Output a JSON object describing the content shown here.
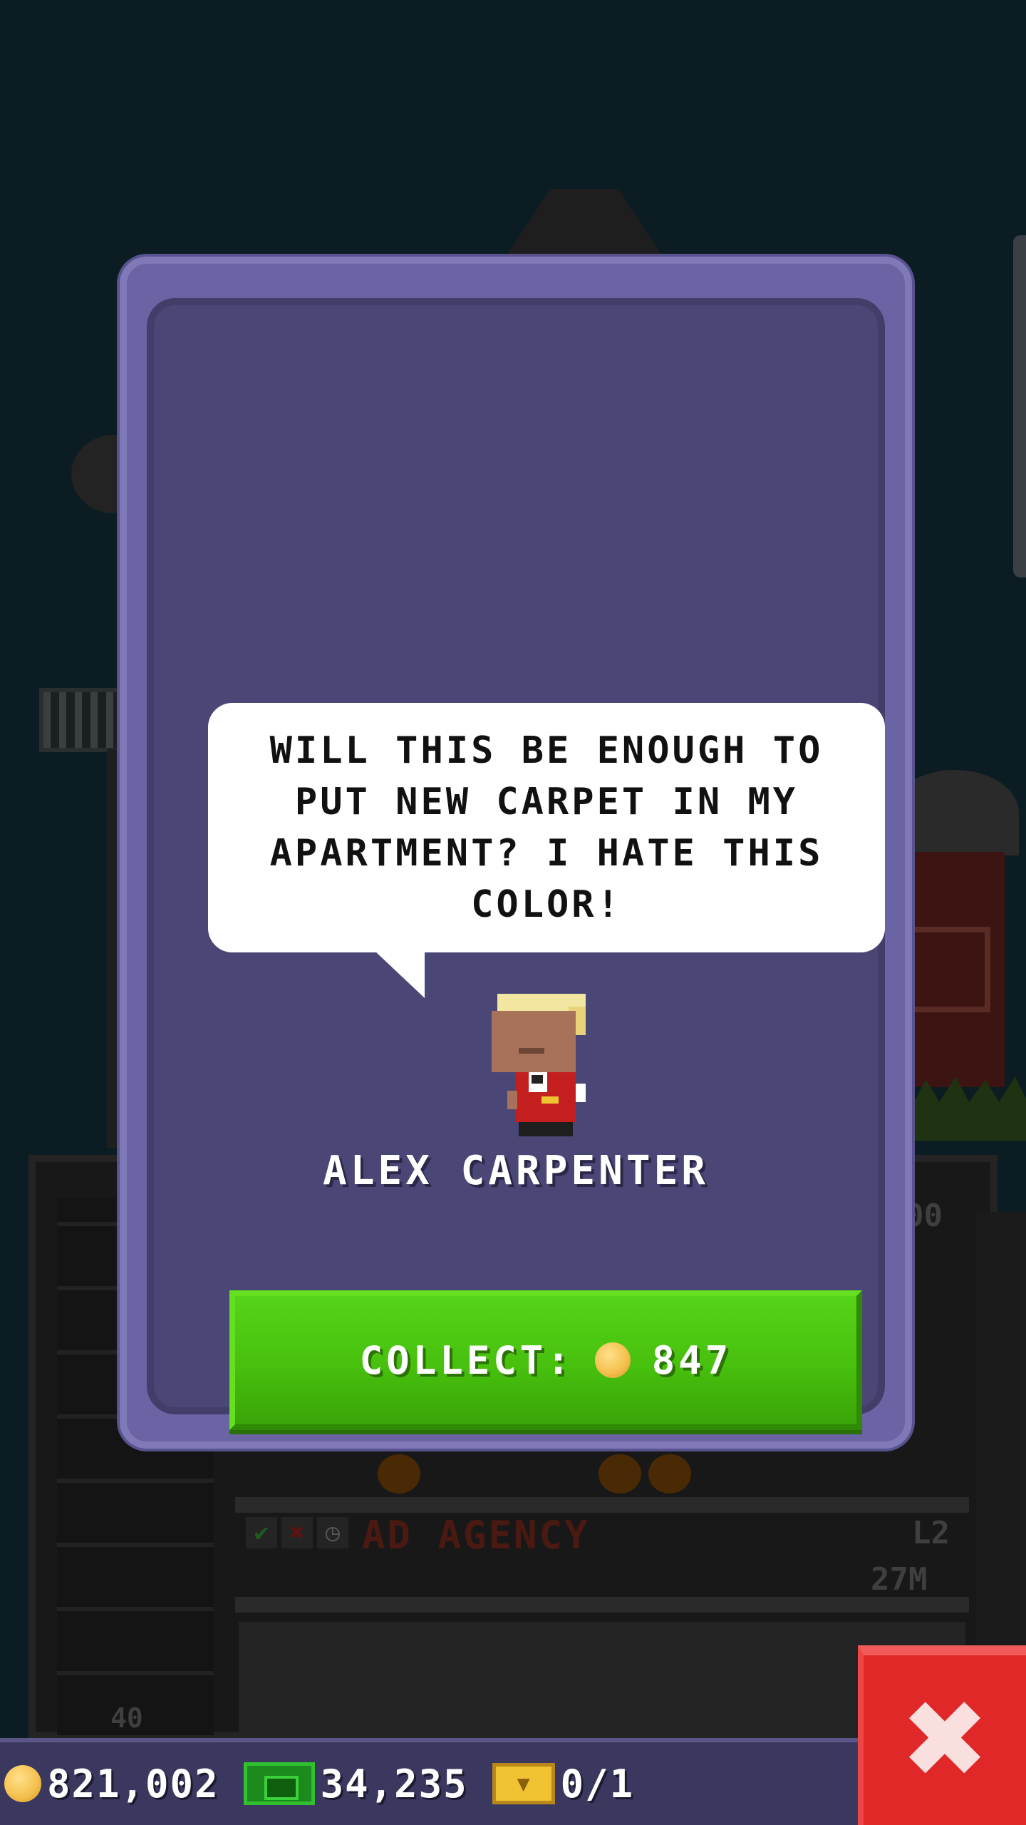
{
  "dialog": {
    "quote": "WILL THIS BE ENOUGH TO PUT NEW CARPET IN MY APARTMENT? I HATE THIS COLOR!",
    "character_name": "ALEX CARPENTER",
    "collect_label": "COLLECT:",
    "collect_amount": "847"
  },
  "background": {
    "floor_name": "AD AGENCY",
    "floor_level": "L2",
    "floor_income": "27M",
    "side_value": "00",
    "floor_number": "40"
  },
  "bottom_bar": {
    "coins": "821,002",
    "bux": "34,235",
    "tickets": "0/1"
  },
  "icons": {
    "coin": "coin-icon",
    "bux": "bux-icon",
    "ticket": "golden-ticket-icon",
    "close": "close-icon"
  },
  "colors": {
    "dialog_frame": "#6a64a4",
    "dialog_inner": "#4a4676",
    "collect_button": "#4cc410",
    "close_button": "#e02828",
    "bottom_bar": "#3b3860"
  }
}
